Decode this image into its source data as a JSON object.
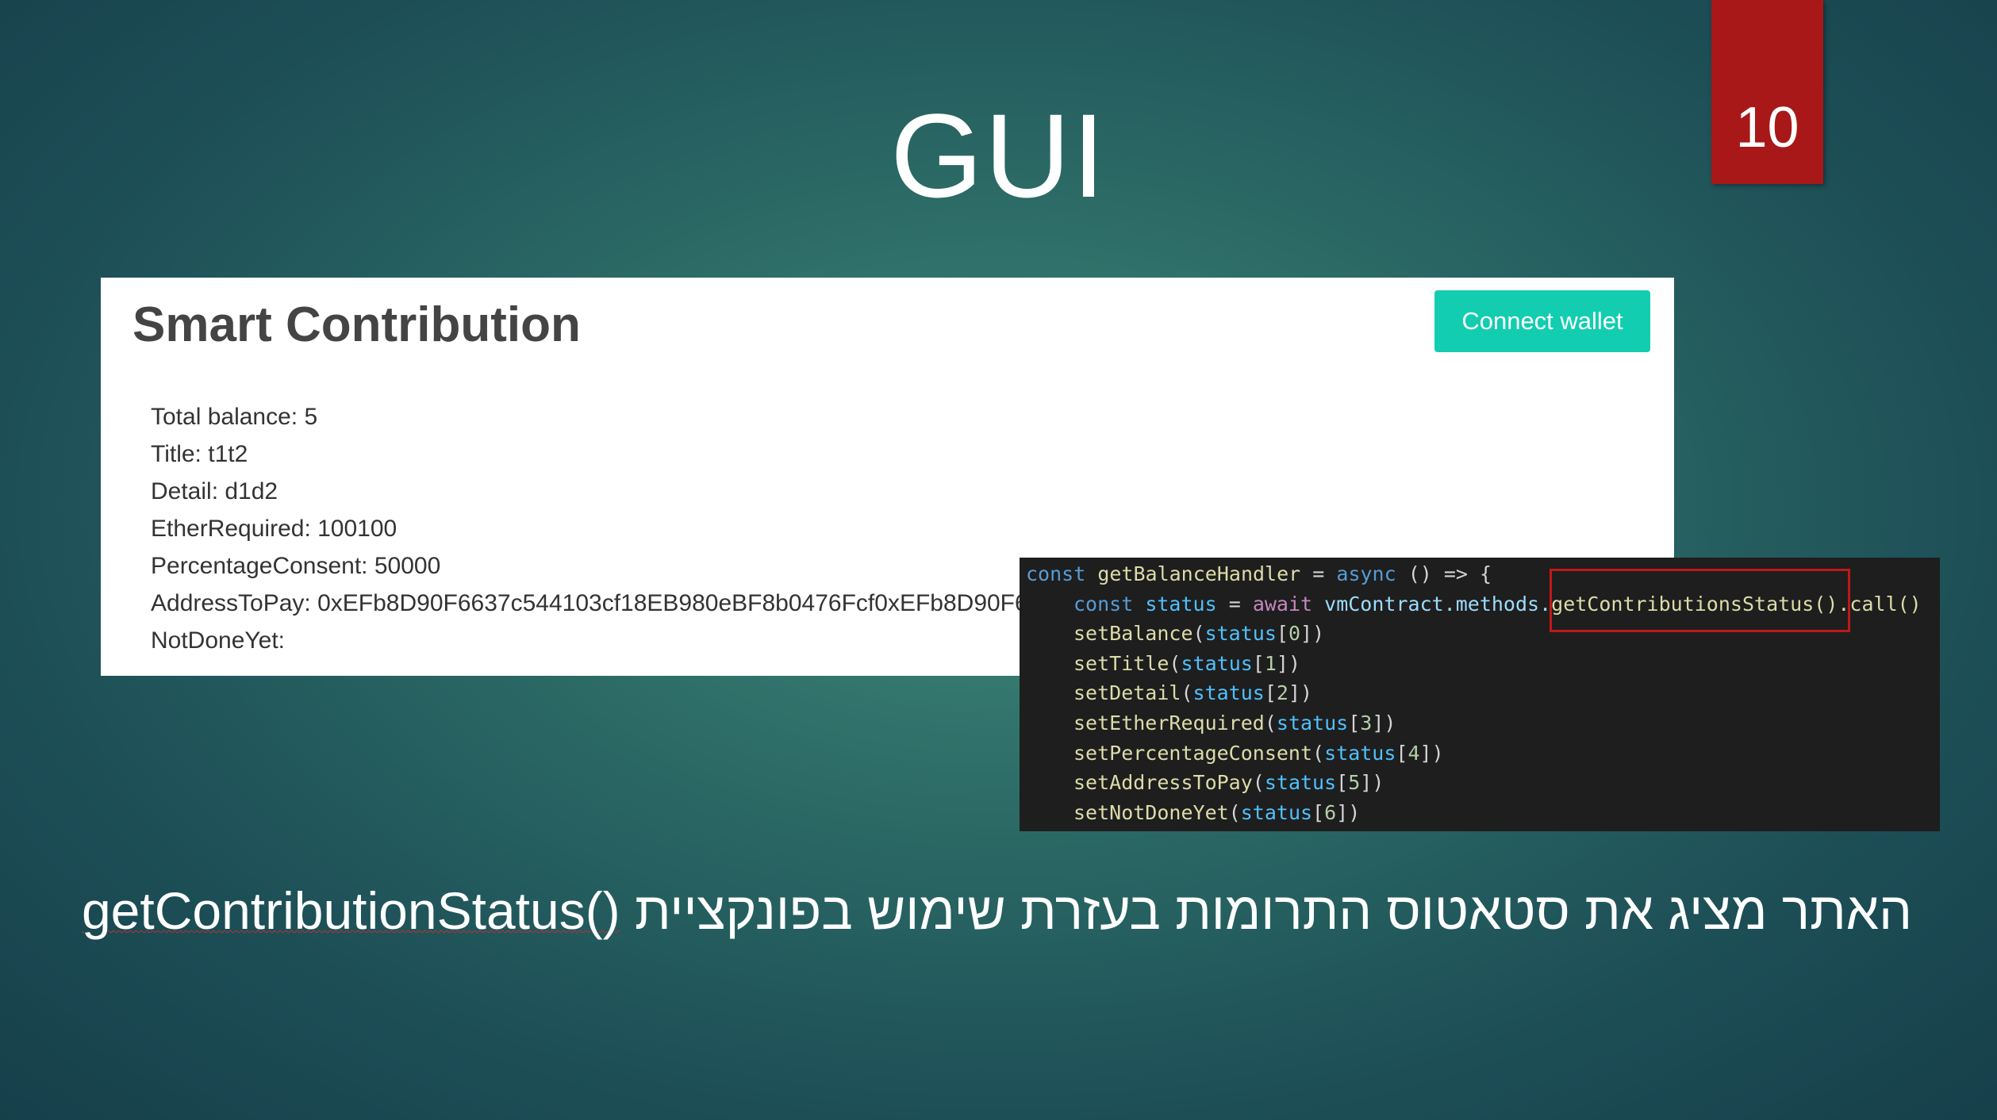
{
  "slide": {
    "title": "GUI",
    "number": "10",
    "caption_hebrew": "האתר מציג את סטאטוס התרומות בעזרת שימוש בפונקציית",
    "caption_function": "getContributionStatus()"
  },
  "app": {
    "title": "Smart Contribution",
    "connect_label": "Connect wallet",
    "fields": [
      "Total balance: 5",
      "Title: t1t2",
      "Detail: d1d2",
      "EtherRequired: 100100",
      "PercentageConsent: 50000",
      "AddressToPay: 0xEFb8D90F6637c544103cf18EB980eBF8b0476Fcf0xEFb8D90F66",
      "NotDoneYet:"
    ]
  },
  "code": {
    "line1": {
      "kw": "const",
      "name": "getBalanceHandler",
      "eq": "=",
      "async": "async",
      "rest": "() => {"
    },
    "line2": {
      "kw": "const",
      "var": "status",
      "eq": "=",
      "await": "await",
      "obj": "vmContract.methods.",
      "method": "getContributionsStatus()",
      "call": ".call()"
    },
    "calls": [
      {
        "fn": "setBalance",
        "arg": "status",
        "idx": "0"
      },
      {
        "fn": "setTitle",
        "arg": "status",
        "idx": "1"
      },
      {
        "fn": "setDetail",
        "arg": "status",
        "idx": "2"
      },
      {
        "fn": "setEtherRequired",
        "arg": "status",
        "idx": "3"
      },
      {
        "fn": "setPercentageConsent",
        "arg": "status",
        "idx": "4"
      },
      {
        "fn": "setAddressToPay",
        "arg": "status",
        "idx": "5"
      },
      {
        "fn": "setNotDoneYet",
        "arg": "status",
        "idx": "6"
      }
    ]
  },
  "colors": {
    "badge": "#a81818",
    "button": "#12cdb0",
    "highlight": "#c01818"
  }
}
